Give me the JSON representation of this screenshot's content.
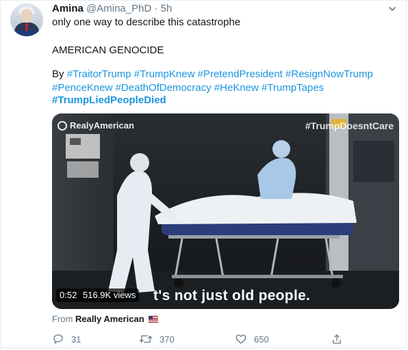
{
  "tweet": {
    "display_name": "Amina",
    "handle": "@Amina_PhD",
    "separator": "·",
    "time": "5h",
    "line1": "only one way to describe this catastrophe",
    "line2": "AMERICAN GENOCIDE",
    "by_label": "By",
    "hashtags_row1": [
      "#TraitorTrump",
      "#TrumpKnew",
      "#PretendPresident",
      "#ResignNowTrump"
    ],
    "hashtags_row2": [
      "#PenceKnew",
      "#DeathOfDemocracy",
      "#HeKnew",
      "#TrumpTapes"
    ],
    "hashtag_bold": "#TrumpLiedPeopleDied"
  },
  "media": {
    "source_logo": "RealyAmerican",
    "watermark": "#TrumpDoesntCare",
    "caption": "t's not just old people.",
    "duration": "0:52",
    "views": "516.9K views"
  },
  "attribution": {
    "prefix": "From",
    "source": "Really American"
  },
  "actions": {
    "reply_count": "31",
    "retweet_count": "370",
    "like_count": "650"
  },
  "icons": [
    "chevron-down-icon",
    "reply-icon",
    "retweet-icon",
    "like-icon",
    "share-icon",
    "us-flag-icon"
  ],
  "colors": {
    "link": "#1b95e0",
    "text": "#14171a",
    "muted": "#657786",
    "border": "#e6ecf0"
  }
}
